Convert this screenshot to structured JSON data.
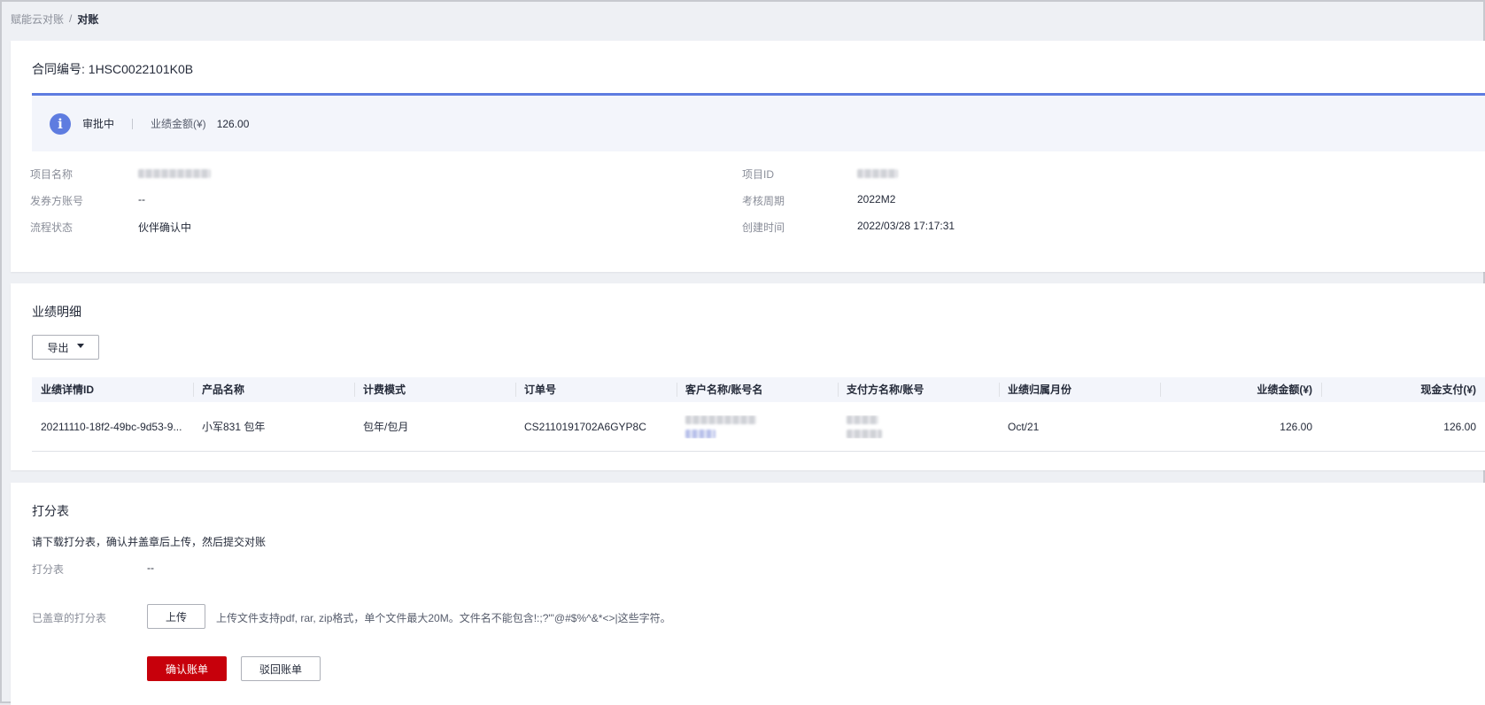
{
  "breadcrumb": {
    "parent": "赋能云对账",
    "separator": "/",
    "current": "对账"
  },
  "contract": {
    "label": "合同编号:",
    "value": "1HSC0022101K0B"
  },
  "status_bar": {
    "icon": "info-icon",
    "status": "审批中",
    "amount_label": "业绩金额(¥)",
    "amount_value": "126.00",
    "accent_color": "#5e7ce0"
  },
  "details": {
    "left": [
      {
        "label": "项目名称",
        "value": "",
        "blurred": true
      },
      {
        "label": "发券方账号",
        "value": "--"
      },
      {
        "label": "流程状态",
        "value": "伙伴确认中"
      }
    ],
    "right": [
      {
        "label": "项目ID",
        "value": "",
        "blurred": true
      },
      {
        "label": "考核周期",
        "value": "2022M2"
      },
      {
        "label": "创建时间",
        "value": "2022/03/28 17:17:31"
      }
    ]
  },
  "performance": {
    "title": "业绩明细",
    "export_label": "导出",
    "columns": [
      "业绩详情ID",
      "产品名称",
      "计费模式",
      "订单号",
      "客户名称/账号名",
      "支付方名称/账号",
      "业绩归属月份",
      "业绩金额(¥)",
      "现金支付(¥)"
    ],
    "rows": [
      {
        "id": "20211110-18f2-49bc-9d53-9...",
        "product": "小军831 包年",
        "billing": "包年/包月",
        "order": "CS2110191702A6GYP8C",
        "customer": "",
        "payer": "",
        "month": "Oct/21",
        "amount": "126.00",
        "cash": "126.00"
      }
    ]
  },
  "scoresheet": {
    "title": "打分表",
    "hint": "请下载打分表，确认并盖章后上传，然后提交对账",
    "sheet_label": "打分表",
    "sheet_value": "--",
    "stamped_label": "已盖章的打分表",
    "upload_label": "上传",
    "upload_hint": "上传文件支持pdf, rar, zip格式，单个文件最大20M。文件名不能包含!:;?\"'@#$%^&*<>|这些字符。",
    "confirm_label": "确认账单",
    "reject_label": "驳回账单",
    "primary_color": "#c7000b"
  }
}
